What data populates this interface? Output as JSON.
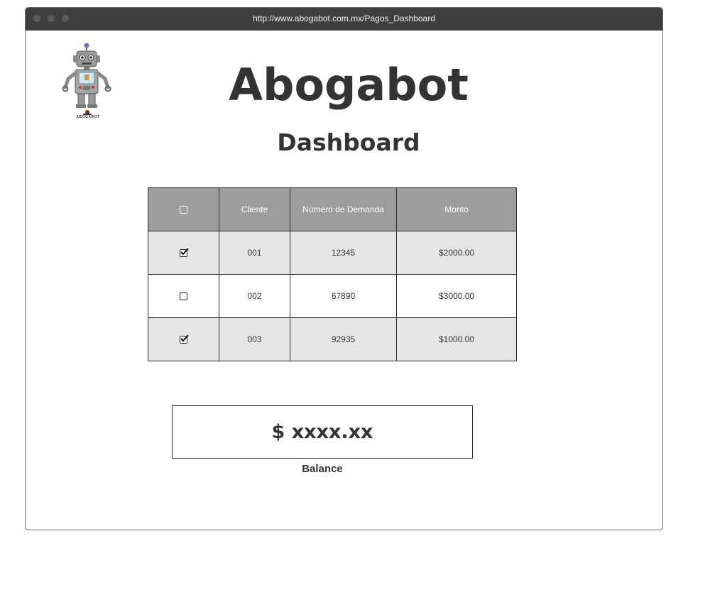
{
  "browser": {
    "url": "http://www.abogabot.com.mx/Pagos_Dashboard"
  },
  "header": {
    "app_title": "Abogabot",
    "page_title": "Dashboard",
    "logo_text": "ABOGABOT"
  },
  "table": {
    "columns": [
      "",
      "Cliente",
      "Número de Demanda",
      "Monto"
    ],
    "rows": [
      {
        "checked": true,
        "cliente": "001",
        "demanda": "12345",
        "monto": "$2000.00"
      },
      {
        "checked": false,
        "cliente": "002",
        "demanda": "67890",
        "monto": "$3000.00"
      },
      {
        "checked": true,
        "cliente": "003",
        "demanda": "92935",
        "monto": "$1000.00"
      }
    ]
  },
  "balance": {
    "value": "$ xxxx.xx",
    "label": "Balance"
  },
  "colors": {
    "titlebar": "#3f3f3f",
    "header_row": "#9d9d9d",
    "alt_row": "#e6e6e6",
    "text": "#333333"
  }
}
